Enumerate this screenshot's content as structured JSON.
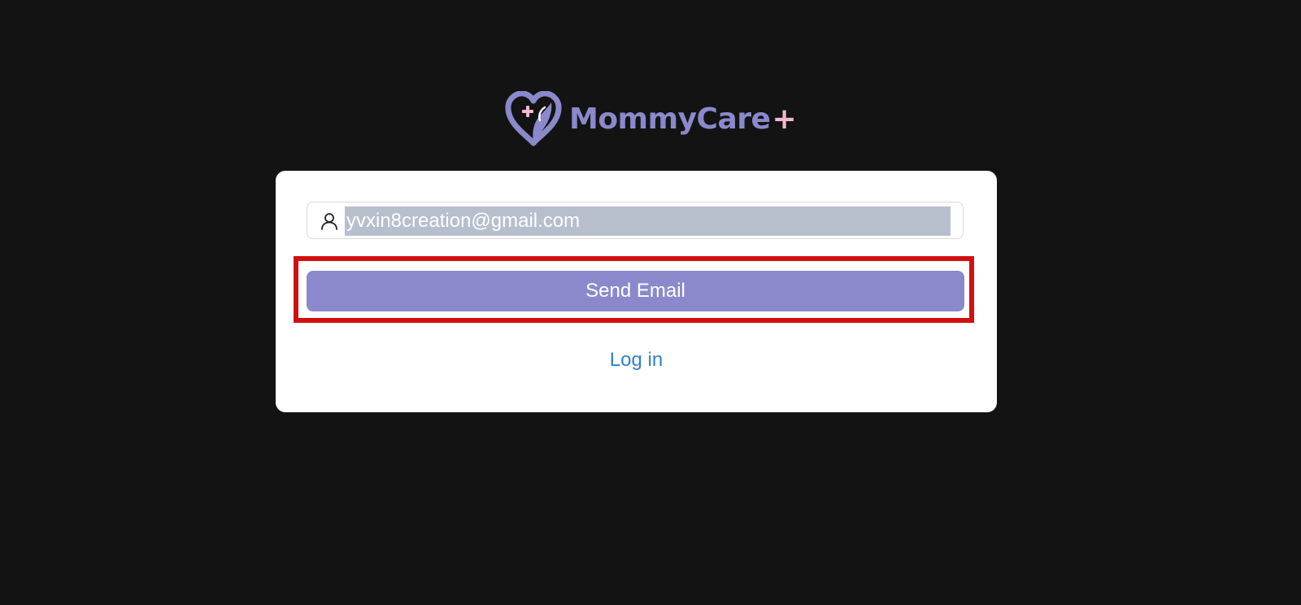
{
  "brand": {
    "name": "MommyCare",
    "suffix": "+",
    "primary_color": "#8b89cb",
    "accent_color": "#f2b8cf",
    "logo_icon": "heart-plus-icon"
  },
  "form": {
    "user_icon": "user-icon",
    "email_value": "yvxin8creation@gmail.com",
    "send_button_label": "Send Email",
    "login_link_label": "Log in",
    "link_color": "#2f7fd0",
    "highlight_color": "#d20f0f"
  }
}
